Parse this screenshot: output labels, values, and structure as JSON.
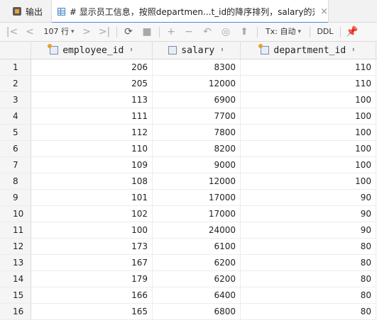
{
  "tabs": [
    {
      "label": "输出",
      "icon": "output-icon"
    },
    {
      "label": "# 显示员工信息，按照departmen...t_id的降序排列，salary的升序排列",
      "icon": "table-icon",
      "close": "×"
    }
  ],
  "toolbar": {
    "row_count": "107 行",
    "tx_mode": "Tx: 自动",
    "ddl": "DDL"
  },
  "columns": [
    {
      "name": "employee_id",
      "icon": "primary-key-column-icon"
    },
    {
      "name": "salary",
      "icon": "column-icon"
    },
    {
      "name": "department_id",
      "icon": "foreign-key-column-icon"
    }
  ],
  "rows": [
    {
      "n": "1",
      "employee_id": "206",
      "salary": "8300",
      "department_id": "110"
    },
    {
      "n": "2",
      "employee_id": "205",
      "salary": "12000",
      "department_id": "110"
    },
    {
      "n": "3",
      "employee_id": "113",
      "salary": "6900",
      "department_id": "100"
    },
    {
      "n": "4",
      "employee_id": "111",
      "salary": "7700",
      "department_id": "100"
    },
    {
      "n": "5",
      "employee_id": "112",
      "salary": "7800",
      "department_id": "100"
    },
    {
      "n": "6",
      "employee_id": "110",
      "salary": "8200",
      "department_id": "100"
    },
    {
      "n": "7",
      "employee_id": "109",
      "salary": "9000",
      "department_id": "100"
    },
    {
      "n": "8",
      "employee_id": "108",
      "salary": "12000",
      "department_id": "100"
    },
    {
      "n": "9",
      "employee_id": "101",
      "salary": "17000",
      "department_id": "90"
    },
    {
      "n": "10",
      "employee_id": "102",
      "salary": "17000",
      "department_id": "90"
    },
    {
      "n": "11",
      "employee_id": "100",
      "salary": "24000",
      "department_id": "90"
    },
    {
      "n": "12",
      "employee_id": "173",
      "salary": "6100",
      "department_id": "80"
    },
    {
      "n": "13",
      "employee_id": "167",
      "salary": "6200",
      "department_id": "80"
    },
    {
      "n": "14",
      "employee_id": "179",
      "salary": "6200",
      "department_id": "80"
    },
    {
      "n": "15",
      "employee_id": "166",
      "salary": "6400",
      "department_id": "80"
    },
    {
      "n": "16",
      "employee_id": "165",
      "salary": "6800",
      "department_id": "80"
    }
  ]
}
